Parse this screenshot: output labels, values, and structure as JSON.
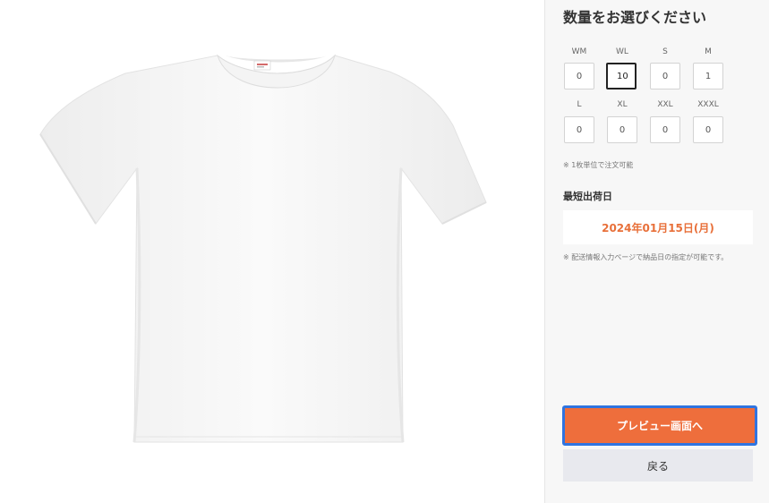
{
  "panel": {
    "title": "数量をお選びください",
    "sizes": [
      {
        "label": "WM",
        "value": "0"
      },
      {
        "label": "WL",
        "value": "10"
      },
      {
        "label": "S",
        "value": "0"
      },
      {
        "label": "M",
        "value": "1"
      },
      {
        "label": "L",
        "value": "0"
      },
      {
        "label": "XL",
        "value": "0"
      },
      {
        "label": "XXL",
        "value": "0"
      },
      {
        "label": "XXXL",
        "value": "0"
      }
    ],
    "unit_note": "※ 1枚単位で注文可能",
    "shipping_label": "最短出荷日",
    "shipping_date": "2024年01月15日(月)",
    "delivery_note": "※ 配送情報入力ページで納品日の指定が可能です。",
    "preview_button": "プレビュー画面へ",
    "back_button": "戻る"
  },
  "colors": {
    "accent": "#ee6e3c",
    "date_text": "#e8703a",
    "focus_ring": "#2f74e0"
  },
  "product": {
    "image": "white-tshirt"
  }
}
